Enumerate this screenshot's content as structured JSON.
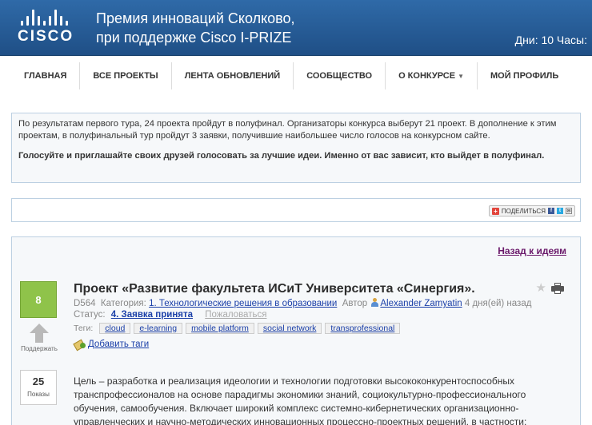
{
  "header": {
    "logo_text": "CISCO",
    "title_line1": "Премия инноваций Сколково,",
    "title_line2": "при поддержке Cisco I-PRIZE",
    "days": "Дни: 10 Часы:"
  },
  "nav": {
    "items": [
      {
        "label": "Главная"
      },
      {
        "label": "Все проекты"
      },
      {
        "label": "Лента обновлений"
      },
      {
        "label": "Сообщество"
      },
      {
        "label": "О конкурсе",
        "has_dropdown": true
      },
      {
        "label": "Мой профиль"
      }
    ]
  },
  "info": {
    "text1": "По результатам первого тура, 24 проекта пройдут в полуфинал. Организаторы конкурса выберут 21 проект.  В дополнение к этим проектам, в полуфинальный тур пройдут 3 заявки, получившие наибольшее число голосов на конкурсном сайте.",
    "text2": "Голосуйте и приглашайте своих друзей голосовать за лучшие идеи. Именно от вас зависит, кто выйдет в полуфинал."
  },
  "share": {
    "label": "ПОДЕЛИТЬСЯ",
    "icons": [
      "facebook-icon",
      "twitter-icon",
      "email-icon"
    ]
  },
  "project": {
    "back_link": "Назад к идеям",
    "votes": "8",
    "vote_label": "Поддержать",
    "views": "25",
    "views_label": "Показы",
    "title": "Проект «Развитие факультета ИСиТ Университета «Синергия».",
    "id": "D564",
    "category_label": "Категория:",
    "category": "1. Технологические решения в образовании",
    "author_label": "Автор",
    "author": "Alexander Zamyatin",
    "age": "4 дня(ей) назад",
    "status_label": "Статус:",
    "status": "4. Заявка принята",
    "complain": "Пожаловаться",
    "tags_label": "Теги:",
    "tags": [
      "cloud",
      "e-learning",
      "mobile platform",
      "social network",
      "transprofessional"
    ],
    "add_tags": "Добавить таги",
    "description": "Цель – разработка и реализация идеологии и технологии подготовки высококонкурентоспособных транспрофессионалов на основе парадигмы экономики знаний, социокультурно-профессионального обучения, самообучения. Включает широкий комплекс системно-кибернетических организационно-управленческих и научно-методических инновационных процессно-проектных решений, в частности:"
  }
}
